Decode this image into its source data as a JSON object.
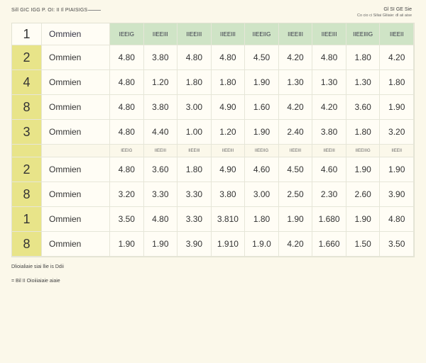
{
  "header": {
    "left": "Sill GIC IGG P. OI: II Il PIAISIGS",
    "right_line1": "Gl SI GE Sie",
    "right_line2": "Co cio ci Siliai Gliiaie: dl aii aise"
  },
  "table": {
    "header_index": "1",
    "header_name": "Ommien",
    "column_headers": [
      "IEEIG",
      "IIEEIII",
      "IIEEIII",
      "IIEEIII",
      "IIEEIIG",
      "IIEEIII",
      "IIEEIII",
      "IIEEIIIG",
      "IIEEII"
    ],
    "rows_top": [
      {
        "index": "2",
        "name": "Ommien",
        "values": [
          "4.80",
          "3.80",
          "4.80",
          "4.80",
          "4.50",
          "4.20",
          "4.80",
          "1.80",
          "4.20"
        ]
      },
      {
        "index": "4",
        "name": "Ommien",
        "values": [
          "4.80",
          "1.20",
          "1.80",
          "1.80",
          "1.90",
          "1.30",
          "1.30",
          "1.30",
          "1.80"
        ]
      },
      {
        "index": "8",
        "name": "Ommien",
        "values": [
          "4.80",
          "3.80",
          "3.00",
          "4.90",
          "1.60",
          "4.20",
          "4.20",
          "3.60",
          "1.90"
        ]
      },
      {
        "index": "3",
        "name": "Ommien",
        "values": [
          "4.80",
          "4.40",
          "1.00",
          "1.20",
          "1.90",
          "2.40",
          "3.80",
          "1.80",
          "3.20"
        ]
      }
    ],
    "sub_headers": [
      "IEEIG",
      "IIEEIII",
      "IIEEIII",
      "IIEEIII",
      "IIEEIIG",
      "IIEEIII",
      "IIEEIII",
      "IIEEIIIG",
      "IIEEII"
    ],
    "rows_bottom": [
      {
        "index": "2",
        "name": "Ommien",
        "values": [
          "4.80",
          "3.60",
          "1.80",
          "4.90",
          "4.60",
          "4.50",
          "4.60",
          "1.90",
          "1.90"
        ]
      },
      {
        "index": "8",
        "name": "Ommien",
        "values": [
          "3.20",
          "3.30",
          "3.30",
          "3.80",
          "3.00",
          "2.50",
          "2.30",
          "2.60",
          "3.90"
        ]
      },
      {
        "index": "1",
        "name": "Ommien",
        "values": [
          "3.50",
          "4.80",
          "3.30",
          "3.810",
          "1.80",
          "1.90",
          "1.680",
          "1.90",
          "4.80"
        ]
      },
      {
        "index": "8",
        "name": "Ommien",
        "values": [
          "1.90",
          "1.90",
          "3.90",
          "1.910",
          "1.9.0",
          "4.20",
          "1.660",
          "1.50",
          "3.50"
        ]
      }
    ]
  },
  "footer": {
    "note1": "Dlioialiaie siai llie is Ddii",
    "note2": "= Bil II Oioiiiaiaie aiaie"
  }
}
